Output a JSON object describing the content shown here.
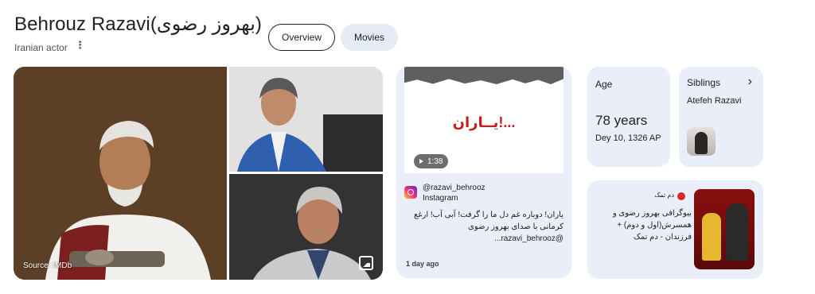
{
  "header": {
    "title": "Behrouz Razavi(بهروز رضوی)",
    "subtitle": "Iranian actor",
    "more_icon": "⋮"
  },
  "tabs": [
    {
      "label": "Overview",
      "selected": true
    },
    {
      "label": "Movies",
      "selected": false
    }
  ],
  "photos": {
    "source_label": "Source: IMDb"
  },
  "video_card": {
    "thumbnail_text": "یــاران!...",
    "duration": "1:38",
    "handle": "@razavi_behrooz",
    "platform": "Instagram",
    "caption": "یاران! دوباره غم دل ما را گرفت! آبی آب! ارغع کرمانی با صدای بهروز رضوی @razavi_behrooz...",
    "date": "1 day ago"
  },
  "age_card": {
    "label": "Age",
    "value": "78 years",
    "birth_date": "Dey 10, 1326 AP"
  },
  "siblings_card": {
    "label": "Siblings",
    "chevron": "›",
    "name": "Atefeh Razavi"
  },
  "news_card": {
    "source": "دم تمک",
    "headline": "بیوگرافی بهروز رضوی و همسرش(اول و دوم) + فرزندان - دم تمک"
  },
  "colors": {
    "card_bg": "#e9eef8",
    "chip_selected_border": "#1f1f1f",
    "chip_bg": "#e4ebf7",
    "video_text": "#c31d1d"
  }
}
